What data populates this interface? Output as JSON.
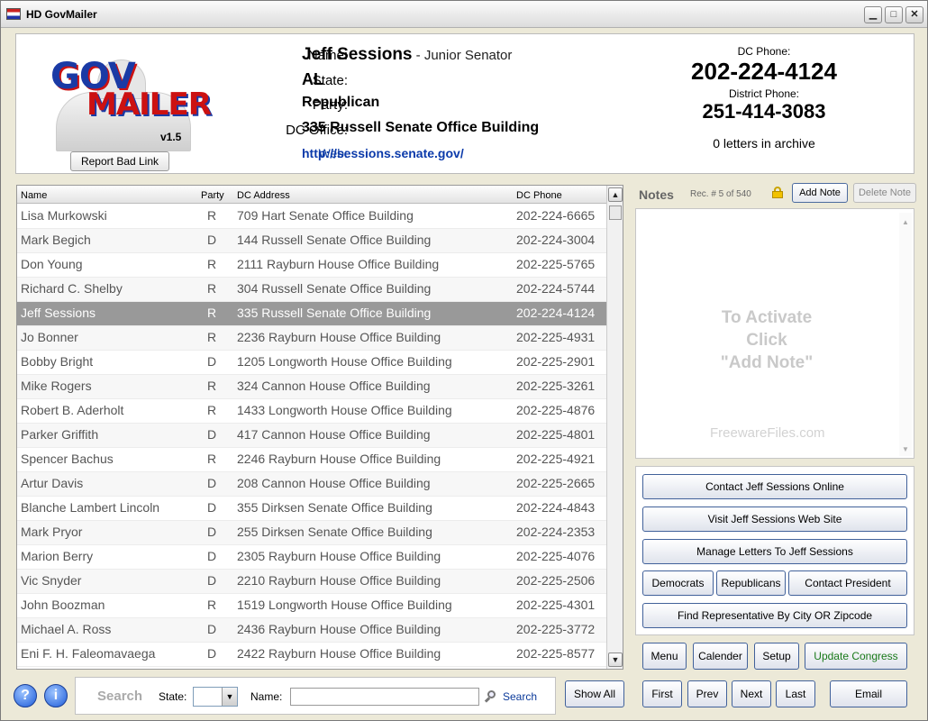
{
  "window": {
    "title": "HD GovMailer"
  },
  "header": {
    "logo_top": "GOV",
    "logo_bottom": "MAILER",
    "version": "v1.5",
    "report_bad_link": "Report Bad Link",
    "labels": {
      "name": "Name:",
      "state": "State:",
      "party": "Party:",
      "dc_office": "DC Office:",
      "web": "Web:"
    },
    "values": {
      "name": "Jeff Sessions",
      "title_suffix": " - Junior Senator",
      "state": "AL",
      "party": "Republican",
      "dc_office": "335 Russell Senate Office Building",
      "web": "http://sessions.senate.gov/"
    },
    "dc_phone_label": "DC Phone:",
    "dc_phone": "202-224-4124",
    "district_phone_label": "District Phone:",
    "district_phone": "251-414-3083",
    "archive": "0 letters in archive"
  },
  "list": {
    "columns": [
      "Name",
      "Party",
      "DC Address",
      "DC Phone"
    ],
    "selected_index": 4,
    "rows": [
      {
        "name": "Lisa Murkowski",
        "party": "R",
        "addr": "709 Hart Senate Office Building",
        "phone": "202-224-6665"
      },
      {
        "name": "Mark Begich",
        "party": "D",
        "addr": "144 Russell Senate Office Building",
        "phone": "202-224-3004"
      },
      {
        "name": "Don Young",
        "party": "R",
        "addr": "2111 Rayburn House Office Building",
        "phone": "202-225-5765"
      },
      {
        "name": "Richard C. Shelby",
        "party": "R",
        "addr": "304 Russell Senate Office Building",
        "phone": "202-224-5744"
      },
      {
        "name": "Jeff Sessions",
        "party": "R",
        "addr": "335 Russell Senate Office Building",
        "phone": "202-224-4124"
      },
      {
        "name": "Jo Bonner",
        "party": "R",
        "addr": "2236 Rayburn House Office Building",
        "phone": "202-225-4931"
      },
      {
        "name": "Bobby Bright",
        "party": "D",
        "addr": "1205 Longworth House Office Building",
        "phone": "202-225-2901"
      },
      {
        "name": "Mike Rogers",
        "party": "R",
        "addr": "324 Cannon House Office Building",
        "phone": "202-225-3261"
      },
      {
        "name": "Robert B. Aderholt",
        "party": "R",
        "addr": "1433 Longworth House Office Building",
        "phone": "202-225-4876"
      },
      {
        "name": "Parker Griffith",
        "party": "D",
        "addr": "417 Cannon House Office Building",
        "phone": "202-225-4801"
      },
      {
        "name": "Spencer Bachus",
        "party": "R",
        "addr": "2246 Rayburn House Office Building",
        "phone": "202-225-4921"
      },
      {
        "name": "Artur Davis",
        "party": "D",
        "addr": "208 Cannon House Office Building",
        "phone": "202-225-2665"
      },
      {
        "name": "Blanche Lambert Lincoln",
        "party": "D",
        "addr": "355 Dirksen Senate Office Building",
        "phone": "202-224-4843"
      },
      {
        "name": "Mark Pryor",
        "party": "D",
        "addr": "255 Dirksen Senate Office Building",
        "phone": "202-224-2353"
      },
      {
        "name": "Marion Berry",
        "party": "D",
        "addr": "2305 Rayburn House Office Building",
        "phone": "202-225-4076"
      },
      {
        "name": "Vic Snyder",
        "party": "D",
        "addr": "2210 Rayburn House Office Building",
        "phone": "202-225-2506"
      },
      {
        "name": "John Boozman",
        "party": "R",
        "addr": "1519 Longworth House Office Building",
        "phone": "202-225-4301"
      },
      {
        "name": "Michael A. Ross",
        "party": "D",
        "addr": "2436 Rayburn House Office Building",
        "phone": "202-225-3772"
      },
      {
        "name": "Eni F. H. Faleomavaega",
        "party": "D",
        "addr": "2422 Rayburn House Office Building",
        "phone": "202-225-8577"
      }
    ]
  },
  "notes": {
    "title": "Notes",
    "record": "Rec. # 5 of 540",
    "add_note": "Add Note",
    "delete_note": "Delete Note",
    "activate_line1": "To Activate",
    "activate_line2": "Click",
    "activate_line3": "\"Add Note\"",
    "watermark": "FreewareFiles.com"
  },
  "actions": {
    "contact_online": "Contact Jeff Sessions Online",
    "visit_site": "Visit Jeff Sessions Web Site",
    "manage_letters": "Manage Letters To Jeff Sessions",
    "democrats": "Democrats",
    "republicans": "Republicans",
    "contact_president": "Contact President",
    "find_rep": "Find Representative By City OR Zipcode"
  },
  "toolbar": {
    "menu": "Menu",
    "calender": "Calender",
    "setup": "Setup",
    "update_congress": "Update Congress",
    "first": "First",
    "prev": "Prev",
    "next": "Next",
    "last": "Last",
    "email": "Email",
    "show_all": "Show All"
  },
  "search": {
    "label": "Search",
    "state_label": "State:",
    "state_value": "",
    "name_label": "Name:",
    "name_value": "",
    "button": "Search"
  },
  "colors": {
    "selected_row": "#999999",
    "update_congress_text": "#1a7a1a",
    "link": "#0b3aaa"
  }
}
